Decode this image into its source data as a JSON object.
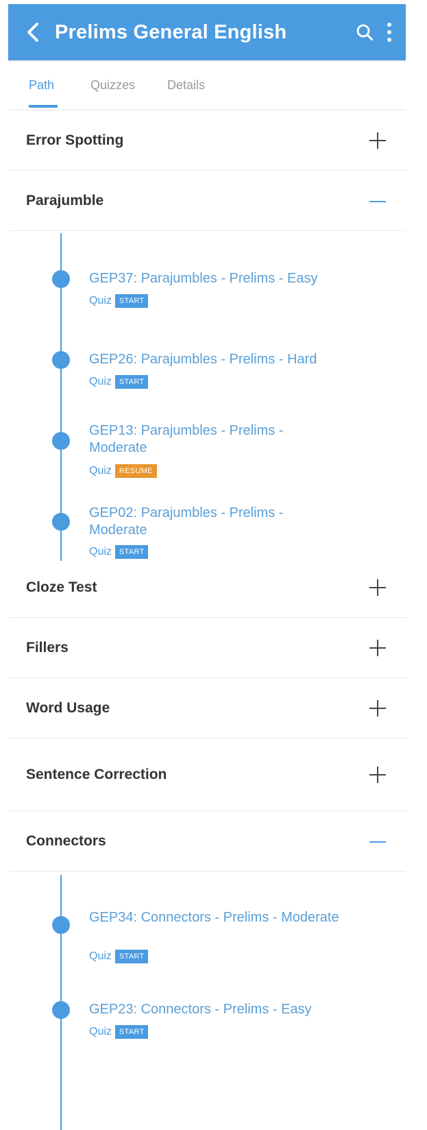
{
  "app_bar": {
    "title": "Prelims General English",
    "back_icon": "chevron-left-icon",
    "search_icon": "search-icon",
    "menu_icon": "more-vert-icon",
    "color": "#4a9be0"
  },
  "tabs": [
    {
      "label": "Path",
      "active": true
    },
    {
      "label": "Quizzes",
      "active": false
    },
    {
      "label": "Details",
      "active": false
    }
  ],
  "sections": [
    {
      "title": "Error Spotting",
      "expanded": false
    },
    {
      "title": "Parajumble",
      "expanded": true,
      "items": [
        {
          "title": "GEP37: Parajumbles - Prelims - Easy",
          "kind": "Quiz",
          "action": "START"
        },
        {
          "title": "GEP26: Parajumbles - Prelims - Hard",
          "kind": "Quiz",
          "action": "START"
        },
        {
          "title": "GEP13: Parajumbles - Prelims - Moderate",
          "kind": "Quiz",
          "action": "RESUME"
        },
        {
          "title": "GEP02: Parajumbles - Prelims - Moderate",
          "kind": "Quiz",
          "action": "START"
        }
      ]
    },
    {
      "title": "Cloze Test",
      "expanded": false
    },
    {
      "title": "Fillers",
      "expanded": false
    },
    {
      "title": "Word Usage",
      "expanded": false
    },
    {
      "title": "Sentence Correction",
      "expanded": false
    },
    {
      "title": "Connectors",
      "expanded": true,
      "items": [
        {
          "title": "GEP34: Connectors - Prelims - Moderate",
          "kind": "Quiz",
          "action": "START"
        },
        {
          "title": "GEP23: Connectors - Prelims - Easy",
          "kind": "Quiz",
          "action": "START"
        }
      ]
    }
  ],
  "colors": {
    "accent": "#4a9be0",
    "resume": "#e8962e"
  }
}
